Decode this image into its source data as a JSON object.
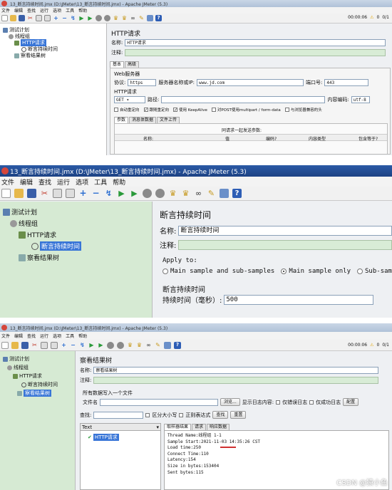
{
  "shot1": {
    "title": "13_断言持续时间.jmx (D:\\JMeter\\13_断言持续时间.jmx) - Apache JMeter (5.3)",
    "menu": [
      "文件",
      "编辑",
      "查找",
      "运行",
      "选项",
      "工具",
      "帮助"
    ],
    "timer": "00:00:06",
    "warn_count": "0",
    "threads": "0/1",
    "tree": [
      "测试计划",
      "线程组",
      "HTTP请求",
      "断言持续时间",
      "察看结果树"
    ],
    "panel_title": "HTTP请求",
    "name_label": "名称:",
    "name_value": "HTTP请求",
    "comment_label": "注释:",
    "tabs": [
      "基本",
      "高级"
    ],
    "web_server_label": "Web服务器",
    "protocol_label": "协议:",
    "protocol_value": "https",
    "server_label": "服务器名称或IP:",
    "server_value": "www.jd.com",
    "port_label": "端口号:",
    "port_value": "443",
    "http_request_label": "HTTP请求",
    "method_value": "GET",
    "path_label": "路径:",
    "encoding_label": "内容编码:",
    "encoding_value": "utf-8",
    "checkboxes": [
      "自动重定向",
      "跟随重定向",
      "使用 KeepAlive",
      "对POST使用multipart / form-data",
      "与浏览器兼容的头"
    ],
    "subtabs": [
      "参数",
      "消息体数据",
      "文件上传"
    ],
    "params_header": "同请求一起发送参数:",
    "columns": [
      "名称:",
      "值",
      "编码?",
      "内容类型",
      "包含等于?"
    ]
  },
  "shot2": {
    "title": "13_断言持续时间.jmx (D:\\JMeter\\13_断言持续时间.jmx) - Apache JMeter (5.3)",
    "menu": [
      "文件",
      "编辑",
      "查找",
      "运行",
      "选项",
      "工具",
      "帮助"
    ],
    "tree": [
      "测试计划",
      "线程组",
      "HTTP请求",
      "断言持续时间",
      "察看结果树"
    ],
    "panel_title": "断言持续时间",
    "name_label": "名称:",
    "name_value": "断言持续时间",
    "comment_label": "注释:",
    "apply_to": "Apply to:",
    "radio_main_sub": "Main sample and sub-samples",
    "radio_main_only": "Main sample only",
    "radio_sub_only": "Sub-sampl",
    "section": "断言持续时间",
    "duration_label": "持续时间（毫秒）:",
    "duration_value": "500"
  },
  "shot3": {
    "title": "13_断言持续时间.jmx (D:\\JMeter\\13_断言持续时间.jmx) - Apache JMeter (5.3)",
    "menu": [
      "文件",
      "编辑",
      "查找",
      "运行",
      "选项",
      "工具",
      "帮助"
    ],
    "timer": "00:00:06",
    "warn_count": "0",
    "threads": "0/1",
    "tree": [
      "测试计划",
      "线程组",
      "HTTP请求",
      "断言持续时间",
      "察看结果树"
    ],
    "panel_title": "察看结果树",
    "name_label": "名称:",
    "name_value": "察看结果树",
    "comment_label": "注释:",
    "all_data_label": "所有数据写入一个文件",
    "filename_label": "文件名",
    "browse_button": "浏览...",
    "log_label": "显示日志内容:",
    "only_errors": "仅错误日志",
    "only_success": "仅成功日志",
    "config_button": "配置",
    "search_label": "查找:",
    "case_label": "区分大小写",
    "regex_label": "正则表达式",
    "find_button": "查找",
    "reset_button": "重置",
    "renderer_value": "Text",
    "result_item": "HTTP请求",
    "result_tabs": [
      "取样器结果",
      "请求",
      "响应数据"
    ],
    "result_lines": [
      "Thread Name:线程组 1-1",
      "Sample Start:2021-11-03 14:35:26 CST",
      "Load time:250",
      "Connect Time:110",
      "Latency:154",
      "Size in bytes:153404",
      "Sent bytes:115"
    ],
    "watermark": "CSDN @猿小鱼"
  }
}
